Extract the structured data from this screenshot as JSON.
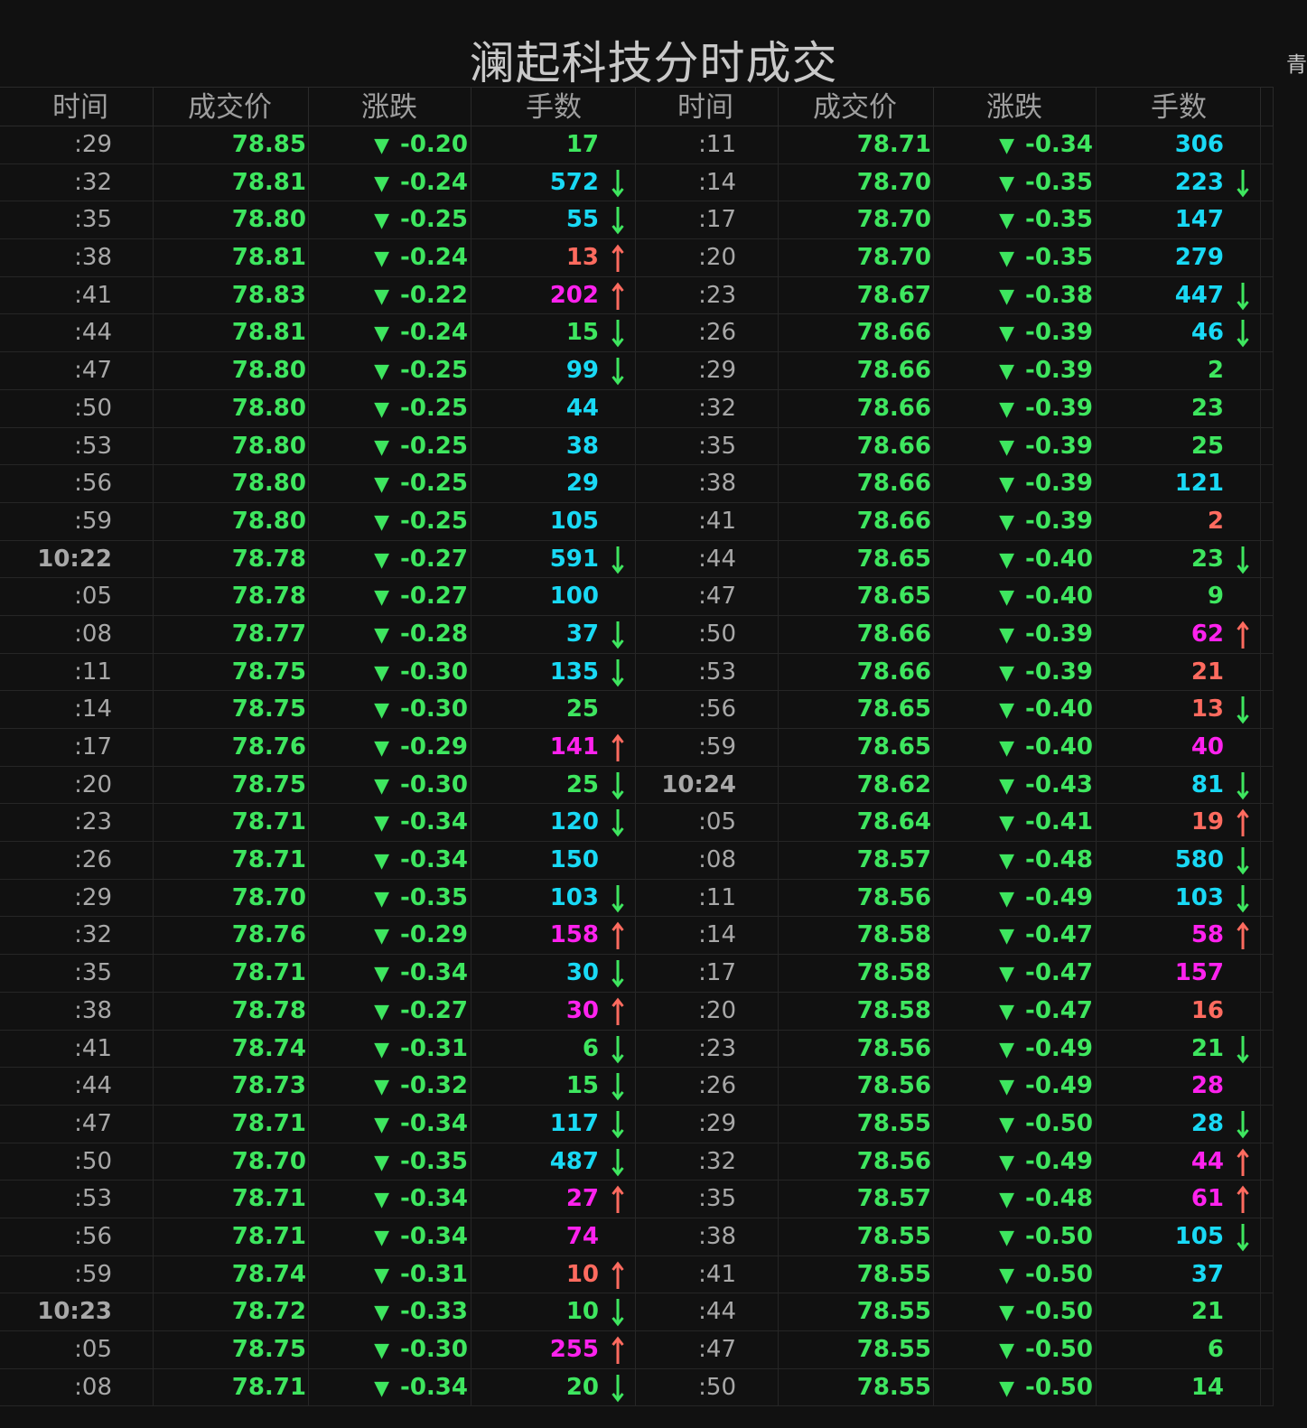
{
  "title": "澜起科技分时成交",
  "corner_text": "青",
  "headers": [
    "时间",
    "成交价",
    "涨跌",
    "手数",
    "时间",
    "成交价",
    "涨跌",
    "手数"
  ],
  "change_marker": "▼",
  "colors": {
    "price_down": "#3ee65f",
    "vol_buy": "#ff6b5f",
    "vol_sell": "#19d9f5",
    "vol_big_buy": "#ff22ee",
    "vol_neutral": "#3ee65f",
    "arrow_up": "#ff6b5f",
    "arrow_down": "#3ee65f"
  },
  "left_rows": [
    {
      "time": ":29",
      "price": "78.85",
      "change": "-0.20",
      "volume": "17",
      "vol_color": "green",
      "arrow": ""
    },
    {
      "time": ":32",
      "price": "78.81",
      "change": "-0.24",
      "volume": "572",
      "vol_color": "cyan",
      "arrow": "down"
    },
    {
      "time": ":35",
      "price": "78.80",
      "change": "-0.25",
      "volume": "55",
      "vol_color": "cyan",
      "arrow": "down"
    },
    {
      "time": ":38",
      "price": "78.81",
      "change": "-0.24",
      "volume": "13",
      "vol_color": "red",
      "arrow": "up"
    },
    {
      "time": ":41",
      "price": "78.83",
      "change": "-0.22",
      "volume": "202",
      "vol_color": "magenta",
      "arrow": "up"
    },
    {
      "time": ":44",
      "price": "78.81",
      "change": "-0.24",
      "volume": "15",
      "vol_color": "green",
      "arrow": "down"
    },
    {
      "time": ":47",
      "price": "78.80",
      "change": "-0.25",
      "volume": "99",
      "vol_color": "cyan",
      "arrow": "down"
    },
    {
      "time": ":50",
      "price": "78.80",
      "change": "-0.25",
      "volume": "44",
      "vol_color": "cyan",
      "arrow": ""
    },
    {
      "time": ":53",
      "price": "78.80",
      "change": "-0.25",
      "volume": "38",
      "vol_color": "cyan",
      "arrow": ""
    },
    {
      "time": ":56",
      "price": "78.80",
      "change": "-0.25",
      "volume": "29",
      "vol_color": "cyan",
      "arrow": ""
    },
    {
      "time": ":59",
      "price": "78.80",
      "change": "-0.25",
      "volume": "105",
      "vol_color": "cyan",
      "arrow": ""
    },
    {
      "time": "10:22",
      "price": "78.78",
      "change": "-0.27",
      "volume": "591",
      "vol_color": "cyan",
      "arrow": "down",
      "full": true
    },
    {
      "time": ":05",
      "price": "78.78",
      "change": "-0.27",
      "volume": "100",
      "vol_color": "cyan",
      "arrow": ""
    },
    {
      "time": ":08",
      "price": "78.77",
      "change": "-0.28",
      "volume": "37",
      "vol_color": "cyan",
      "arrow": "down"
    },
    {
      "time": ":11",
      "price": "78.75",
      "change": "-0.30",
      "volume": "135",
      "vol_color": "cyan",
      "arrow": "down"
    },
    {
      "time": ":14",
      "price": "78.75",
      "change": "-0.30",
      "volume": "25",
      "vol_color": "green",
      "arrow": ""
    },
    {
      "time": ":17",
      "price": "78.76",
      "change": "-0.29",
      "volume": "141",
      "vol_color": "magenta",
      "arrow": "up"
    },
    {
      "time": ":20",
      "price": "78.75",
      "change": "-0.30",
      "volume": "25",
      "vol_color": "green",
      "arrow": "down"
    },
    {
      "time": ":23",
      "price": "78.71",
      "change": "-0.34",
      "volume": "120",
      "vol_color": "cyan",
      "arrow": "down"
    },
    {
      "time": ":26",
      "price": "78.71",
      "change": "-0.34",
      "volume": "150",
      "vol_color": "cyan",
      "arrow": ""
    },
    {
      "time": ":29",
      "price": "78.70",
      "change": "-0.35",
      "volume": "103",
      "vol_color": "cyan",
      "arrow": "down"
    },
    {
      "time": ":32",
      "price": "78.76",
      "change": "-0.29",
      "volume": "158",
      "vol_color": "magenta",
      "arrow": "up"
    },
    {
      "time": ":35",
      "price": "78.71",
      "change": "-0.34",
      "volume": "30",
      "vol_color": "cyan",
      "arrow": "down"
    },
    {
      "time": ":38",
      "price": "78.78",
      "change": "-0.27",
      "volume": "30",
      "vol_color": "magenta",
      "arrow": "up"
    },
    {
      "time": ":41",
      "price": "78.74",
      "change": "-0.31",
      "volume": "6",
      "vol_color": "green",
      "arrow": "down"
    },
    {
      "time": ":44",
      "price": "78.73",
      "change": "-0.32",
      "volume": "15",
      "vol_color": "green",
      "arrow": "down"
    },
    {
      "time": ":47",
      "price": "78.71",
      "change": "-0.34",
      "volume": "117",
      "vol_color": "cyan",
      "arrow": "down"
    },
    {
      "time": ":50",
      "price": "78.70",
      "change": "-0.35",
      "volume": "487",
      "vol_color": "cyan",
      "arrow": "down"
    },
    {
      "time": ":53",
      "price": "78.71",
      "change": "-0.34",
      "volume": "27",
      "vol_color": "magenta",
      "arrow": "up"
    },
    {
      "time": ":56",
      "price": "78.71",
      "change": "-0.34",
      "volume": "74",
      "vol_color": "magenta",
      "arrow": ""
    },
    {
      "time": ":59",
      "price": "78.74",
      "change": "-0.31",
      "volume": "10",
      "vol_color": "red",
      "arrow": "up"
    },
    {
      "time": "10:23",
      "price": "78.72",
      "change": "-0.33",
      "volume": "10",
      "vol_color": "green",
      "arrow": "down",
      "full": true
    },
    {
      "time": ":05",
      "price": "78.75",
      "change": "-0.30",
      "volume": "255",
      "vol_color": "magenta",
      "arrow": "up"
    },
    {
      "time": ":08",
      "price": "78.71",
      "change": "-0.34",
      "volume": "20",
      "vol_color": "green",
      "arrow": "down"
    }
  ],
  "right_rows": [
    {
      "time": ":11",
      "price": "78.71",
      "change": "-0.34",
      "volume": "306",
      "vol_color": "cyan",
      "arrow": ""
    },
    {
      "time": ":14",
      "price": "78.70",
      "change": "-0.35",
      "volume": "223",
      "vol_color": "cyan",
      "arrow": "down"
    },
    {
      "time": ":17",
      "price": "78.70",
      "change": "-0.35",
      "volume": "147",
      "vol_color": "cyan",
      "arrow": ""
    },
    {
      "time": ":20",
      "price": "78.70",
      "change": "-0.35",
      "volume": "279",
      "vol_color": "cyan",
      "arrow": ""
    },
    {
      "time": ":23",
      "price": "78.67",
      "change": "-0.38",
      "volume": "447",
      "vol_color": "cyan",
      "arrow": "down"
    },
    {
      "time": ":26",
      "price": "78.66",
      "change": "-0.39",
      "volume": "46",
      "vol_color": "cyan",
      "arrow": "down"
    },
    {
      "time": ":29",
      "price": "78.66",
      "change": "-0.39",
      "volume": "2",
      "vol_color": "green",
      "arrow": ""
    },
    {
      "time": ":32",
      "price": "78.66",
      "change": "-0.39",
      "volume": "23",
      "vol_color": "green",
      "arrow": ""
    },
    {
      "time": ":35",
      "price": "78.66",
      "change": "-0.39",
      "volume": "25",
      "vol_color": "green",
      "arrow": ""
    },
    {
      "time": ":38",
      "price": "78.66",
      "change": "-0.39",
      "volume": "121",
      "vol_color": "cyan",
      "arrow": ""
    },
    {
      "time": ":41",
      "price": "78.66",
      "change": "-0.39",
      "volume": "2",
      "vol_color": "red",
      "arrow": ""
    },
    {
      "time": ":44",
      "price": "78.65",
      "change": "-0.40",
      "volume": "23",
      "vol_color": "green",
      "arrow": "down"
    },
    {
      "time": ":47",
      "price": "78.65",
      "change": "-0.40",
      "volume": "9",
      "vol_color": "green",
      "arrow": ""
    },
    {
      "time": ":50",
      "price": "78.66",
      "change": "-0.39",
      "volume": "62",
      "vol_color": "magenta",
      "arrow": "up"
    },
    {
      "time": ":53",
      "price": "78.66",
      "change": "-0.39",
      "volume": "21",
      "vol_color": "red",
      "arrow": ""
    },
    {
      "time": ":56",
      "price": "78.65",
      "change": "-0.40",
      "volume": "13",
      "vol_color": "red",
      "arrow": "down"
    },
    {
      "time": ":59",
      "price": "78.65",
      "change": "-0.40",
      "volume": "40",
      "vol_color": "magenta",
      "arrow": ""
    },
    {
      "time": "10:24",
      "price": "78.62",
      "change": "-0.43",
      "volume": "81",
      "vol_color": "cyan",
      "arrow": "down",
      "full": true
    },
    {
      "time": ":05",
      "price": "78.64",
      "change": "-0.41",
      "volume": "19",
      "vol_color": "red",
      "arrow": "up"
    },
    {
      "time": ":08",
      "price": "78.57",
      "change": "-0.48",
      "volume": "580",
      "vol_color": "cyan",
      "arrow": "down"
    },
    {
      "time": ":11",
      "price": "78.56",
      "change": "-0.49",
      "volume": "103",
      "vol_color": "cyan",
      "arrow": "down"
    },
    {
      "time": ":14",
      "price": "78.58",
      "change": "-0.47",
      "volume": "58",
      "vol_color": "magenta",
      "arrow": "up"
    },
    {
      "time": ":17",
      "price": "78.58",
      "change": "-0.47",
      "volume": "157",
      "vol_color": "magenta",
      "arrow": ""
    },
    {
      "time": ":20",
      "price": "78.58",
      "change": "-0.47",
      "volume": "16",
      "vol_color": "red",
      "arrow": ""
    },
    {
      "time": ":23",
      "price": "78.56",
      "change": "-0.49",
      "volume": "21",
      "vol_color": "green",
      "arrow": "down"
    },
    {
      "time": ":26",
      "price": "78.56",
      "change": "-0.49",
      "volume": "28",
      "vol_color": "magenta",
      "arrow": ""
    },
    {
      "time": ":29",
      "price": "78.55",
      "change": "-0.50",
      "volume": "28",
      "vol_color": "cyan",
      "arrow": "down"
    },
    {
      "time": ":32",
      "price": "78.56",
      "change": "-0.49",
      "volume": "44",
      "vol_color": "magenta",
      "arrow": "up"
    },
    {
      "time": ":35",
      "price": "78.57",
      "change": "-0.48",
      "volume": "61",
      "vol_color": "magenta",
      "arrow": "up"
    },
    {
      "time": ":38",
      "price": "78.55",
      "change": "-0.50",
      "volume": "105",
      "vol_color": "cyan",
      "arrow": "down"
    },
    {
      "time": ":41",
      "price": "78.55",
      "change": "-0.50",
      "volume": "37",
      "vol_color": "cyan",
      "arrow": ""
    },
    {
      "time": ":44",
      "price": "78.55",
      "change": "-0.50",
      "volume": "21",
      "vol_color": "green",
      "arrow": ""
    },
    {
      "time": ":47",
      "price": "78.55",
      "change": "-0.50",
      "volume": "6",
      "vol_color": "green",
      "arrow": ""
    },
    {
      "time": ":50",
      "price": "78.55",
      "change": "-0.50",
      "volume": "14",
      "vol_color": "green",
      "arrow": ""
    }
  ]
}
